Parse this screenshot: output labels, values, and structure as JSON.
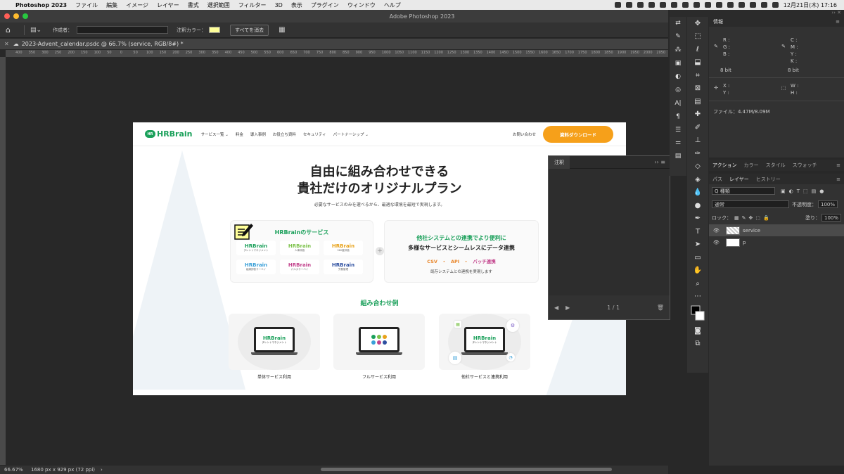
{
  "menubar": {
    "app": "Photoshop 2023",
    "items": [
      "ファイル",
      "編集",
      "イメージ",
      "レイヤー",
      "書式",
      "選択範囲",
      "フィルター",
      "3D",
      "表示",
      "プラグイン",
      "ウィンドウ",
      "ヘルプ"
    ],
    "clock": "12月21日(木) 17:16"
  },
  "window": {
    "title": "Adobe Photoshop 2023"
  },
  "options": {
    "author_label": "作成者：",
    "note_color_label": "注釈カラー：",
    "note_color": "#ffff99",
    "clear_all": "すべてを消去"
  },
  "doctab": {
    "title": "2023-Advent_calendar.psdc @ 66.7% (service, RGB/8#) *"
  },
  "ruler": [
    "400",
    "350",
    "300",
    "250",
    "200",
    "150",
    "100",
    "50",
    "0",
    "50",
    "100",
    "150",
    "200",
    "250",
    "300",
    "350",
    "400",
    "450",
    "500",
    "550",
    "600",
    "650",
    "700",
    "750",
    "800",
    "850",
    "900",
    "950",
    "1000",
    "1050",
    "1100",
    "1150",
    "1200",
    "1250",
    "1300",
    "1350",
    "1400",
    "1450",
    "1500",
    "1550",
    "1600",
    "1650",
    "1700",
    "1750",
    "1800",
    "1850",
    "1900",
    "1950",
    "2000",
    "2050"
  ],
  "site": {
    "logo": "HRBrain",
    "logo_badge": "HR",
    "nav": [
      "サービス一覧 ⌄",
      "料金",
      "導入事例",
      "お役立ち資料",
      "セキュリティ",
      "パートナーシップ ⌄"
    ],
    "contact": "お問い合わせ",
    "download": "資料ダウンロード",
    "hero1": "自由に組み合わせできる",
    "hero2": "貴社だけのオリジナルプラン",
    "lead": "必要なサービスのみを選べるから、最適な環境を最短で実現します。",
    "services_title": "HRBrainのサービス",
    "services": [
      {
        "logo": "HRBrain",
        "sub": "タレントマネジメント",
        "color": "#1aa05a"
      },
      {
        "logo": "HRBrain",
        "sub": "人事評価",
        "color": "#7cc24a"
      },
      {
        "logo": "HRBrain",
        "sub": "360度評価",
        "color": "#e8a21a"
      },
      {
        "logo": "HRBrain",
        "sub": "組織診断サーベイ",
        "color": "#3aa0d8"
      },
      {
        "logo": "HRBrain",
        "sub": "パルスサーベイ",
        "color": "#c2418b"
      },
      {
        "logo": "HRBrain",
        "sub": "労務管理",
        "color": "#2d4fa0"
      }
    ],
    "plus": "+",
    "right_title1": "他社システムとの連携でより便利に",
    "right_title2": "多様なサービスとシームレスにデータ連携",
    "tags": [
      "CSV",
      "API",
      "バッチ連携"
    ],
    "tag_sep": "・",
    "right_note": "既存システムとの連携を実現します",
    "examples_title": "組み合わせ例",
    "examples": [
      "単体サービス利用",
      "フルサービス利用",
      "他社サービスと連携利用"
    ],
    "screen_logo": "HRBrain",
    "screen_sub": "タレントマネジメント"
  },
  "notes_panel": {
    "tab": "注釈",
    "page": "1 / 1",
    "collapse": "››"
  },
  "info_panel": {
    "tab": "情報",
    "left_labels": [
      "R :",
      "G :",
      "B :"
    ],
    "right_labels": [
      "C :",
      "M :",
      "Y :",
      "K :"
    ],
    "left_bits": "8 bit",
    "right_bits": "8 bit",
    "xy": [
      "X :",
      "Y :"
    ],
    "wh": [
      "W :",
      "H :"
    ],
    "file": "ファイル：4.47M/8.09M"
  },
  "panel_tabs1": [
    "アクション",
    "カラー",
    "スタイル",
    "スウォッチ"
  ],
  "panel_tabs2": [
    "パス",
    "レイヤー",
    "ヒストリー"
  ],
  "layers_panel": {
    "kind": "Q 種類",
    "blend": "通常",
    "opacity_label": "不透明度：",
    "opacity": "100%",
    "lock_label": "ロック：",
    "fill_label": "塗り：",
    "fill": "100%",
    "layers": [
      "service",
      "p"
    ]
  },
  "status": {
    "zoom": "66.67%",
    "size": "1680 px x 929 px (72 ppi)",
    "arrow": "›"
  }
}
